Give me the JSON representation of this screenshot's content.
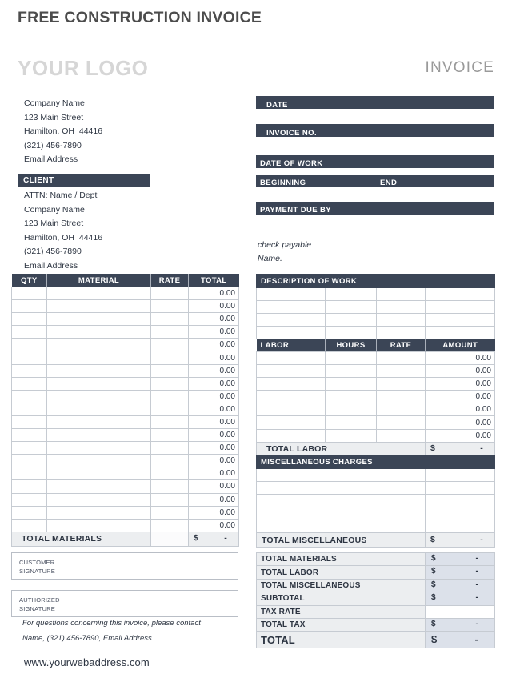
{
  "title": "FREE CONSTRUCTION INVOICE",
  "logo_text": "YOUR LOGO",
  "invoice_word": "INVOICE",
  "company": {
    "lines": [
      "Company Name",
      "123 Main Street",
      "Hamilton, OH  44416",
      "(321) 456-7890",
      "Email Address"
    ]
  },
  "client": {
    "heading": "CLIENT",
    "lines": [
      "ATTN: Name / Dept",
      "Company Name",
      "123 Main Street",
      "Hamilton, OH  44416",
      "(321) 456-7890",
      "Email Address"
    ]
  },
  "header_fields": {
    "date": "DATE",
    "invoice_no": "INVOICE NO.",
    "date_of_work": "DATE OF WORK",
    "beginning": "BEGINNING",
    "end": "END",
    "payment_due_by": "PAYMENT DUE BY"
  },
  "payable_note": {
    "line1": "check payable",
    "line2": "Name."
  },
  "materials_table": {
    "columns": [
      "QTY",
      "MATERIAL",
      "RATE",
      "TOTAL"
    ],
    "row_value": "0.00",
    "row_count": 19,
    "total_label": "TOTAL MATERIALS",
    "total_currency": "$",
    "total_value": "-"
  },
  "description_of_work": {
    "heading": "DESCRIPTION OF WORK",
    "row_count": 4
  },
  "labor_table": {
    "columns": [
      "LABOR",
      "HOURS",
      "RATE",
      "AMOUNT"
    ],
    "row_value": "0.00",
    "row_count": 7,
    "total_label": "TOTAL LABOR",
    "total_currency": "$",
    "total_value": "-"
  },
  "misc_table": {
    "heading": "MISCELLANEOUS CHARGES",
    "row_count": 5,
    "total_label": "TOTAL MISCELLANEOUS",
    "total_currency": "$",
    "total_value": "-"
  },
  "summary": {
    "rows": [
      {
        "label": "TOTAL MATERIALS",
        "currency": "$",
        "value": "-"
      },
      {
        "label": "TOTAL LABOR",
        "currency": "$",
        "value": "-"
      },
      {
        "label": "TOTAL MISCELLANEOUS",
        "currency": "$",
        "value": "-"
      },
      {
        "label": "SUBTOTAL",
        "currency": "$",
        "value": "-"
      },
      {
        "label": "TAX RATE",
        "currency": "",
        "value": ""
      },
      {
        "label": "TOTAL TAX",
        "currency": "$",
        "value": "-"
      },
      {
        "label": "TOTAL",
        "currency": "$",
        "value": "-"
      }
    ]
  },
  "signatures": {
    "customer_line1": "CUSTOMER",
    "customer_line2": "SIGNATURE",
    "authorized_line1": "AUTHORIZED",
    "authorized_line2": "SIGNATURE"
  },
  "footer": {
    "contact_prompt": "For questions concerning this invoice, please contact",
    "contact_details": "Name, (321) 456-7890, Email Address",
    "web_address": "www.yourwebaddress.com"
  },
  "colors": {
    "navy": "#3b4556",
    "logo_gray": "#d6d6d6",
    "summary_label_bg": "#eceef0",
    "summary_value_bg": "#dce1ea"
  }
}
